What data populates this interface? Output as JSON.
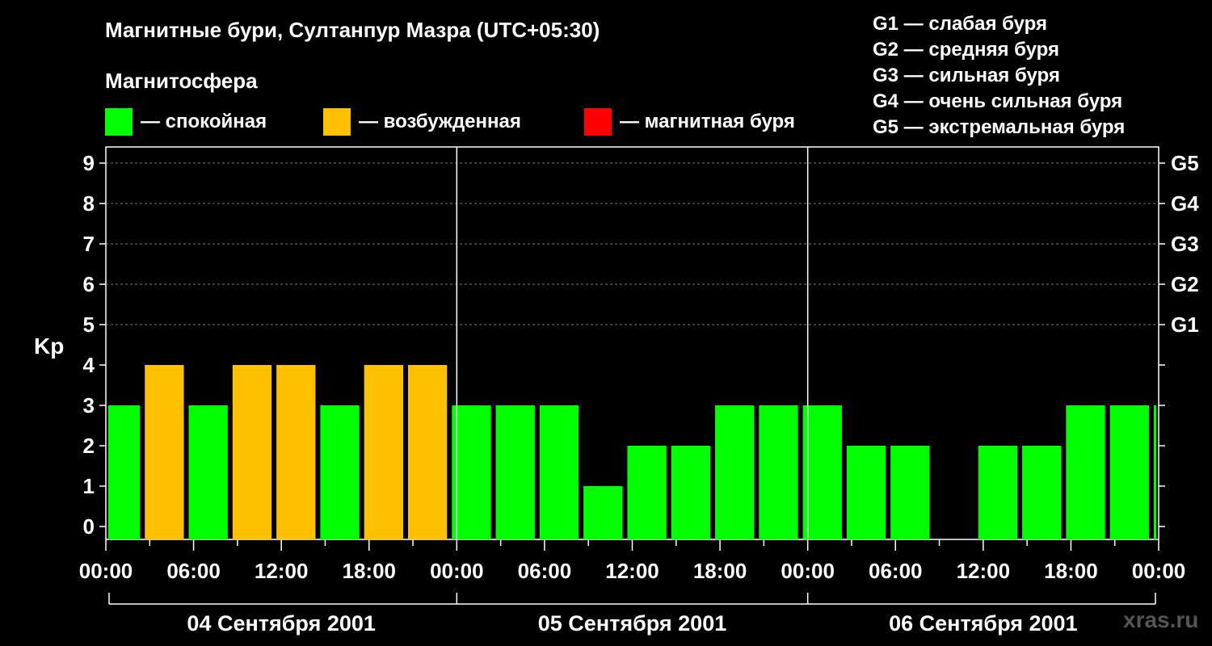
{
  "title": "Магнитные бури, Султанпур Мазра (UTC+05:30)",
  "subtitle": "Магнитосфера",
  "legend": [
    {
      "label": "— спокойная",
      "color": "#00ff00"
    },
    {
      "label": "— возбужденная",
      "color": "#ffc000"
    },
    {
      "label": "— магнитная буря",
      "color": "#ff0000"
    }
  ],
  "g_scale": [
    "G1 — слабая буря",
    "G2 — средняя буря",
    "G3 — сильная буря",
    "G4 — очень сильная буря",
    "G5 — экстремальная буря"
  ],
  "watermark": "xras.ru",
  "chart_data": {
    "type": "bar",
    "ylabel": "Kp",
    "ylim": [
      0,
      9
    ],
    "y_ticks": [
      0,
      1,
      2,
      3,
      4,
      5,
      6,
      7,
      8,
      9
    ],
    "right_axis_labels": [
      {
        "kp": 5,
        "label": "G1"
      },
      {
        "kp": 6,
        "label": "G2"
      },
      {
        "kp": 7,
        "label": "G3"
      },
      {
        "kp": 8,
        "label": "G4"
      },
      {
        "kp": 9,
        "label": "G5"
      }
    ],
    "x_tick_labels": [
      "00:00",
      "06:00",
      "12:00",
      "18:00",
      "00:00",
      "06:00",
      "12:00",
      "18:00",
      "00:00",
      "06:00",
      "12:00",
      "18:00",
      "00:00"
    ],
    "days": [
      "04 Сентября 2001",
      "05 Сентября 2001",
      "06 Сентября 2001"
    ],
    "interval_hours": 3,
    "offset_hours": -0.5,
    "colors": {
      "quiet": "#00ff00",
      "unsettled": "#ffc000",
      "storm": "#ff0000"
    },
    "values": [
      3,
      4,
      3,
      4,
      4,
      3,
      4,
      4,
      3,
      3,
      3,
      1,
      2,
      2,
      3,
      3,
      3,
      2,
      2,
      0,
      2,
      2,
      3,
      3,
      3
    ]
  }
}
